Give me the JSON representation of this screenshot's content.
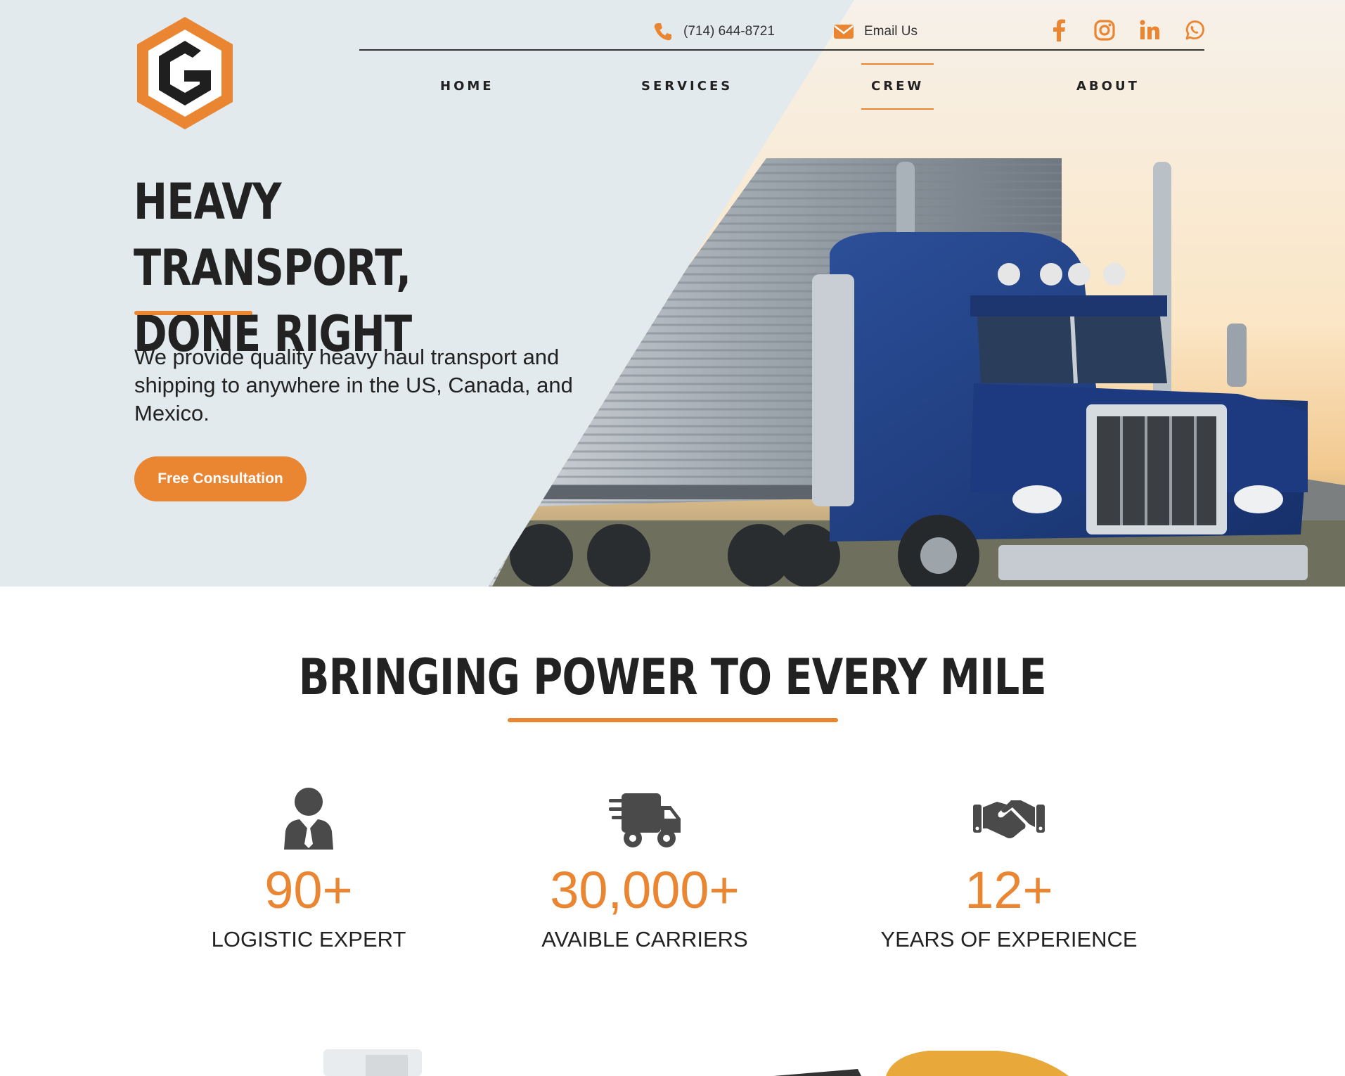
{
  "brand": {
    "accent_color": "#ea8532",
    "dark_color": "#222222",
    "hero_bg": "#e2eaed"
  },
  "header": {
    "logo_icon": "hexagon-g-logo",
    "phone": {
      "icon": "phone-icon",
      "text": "(714) 644-8721"
    },
    "email": {
      "icon": "envelope-icon",
      "text": "Email Us"
    },
    "socials": [
      {
        "name": "facebook",
        "icon": "facebook-icon"
      },
      {
        "name": "instagram",
        "icon": "instagram-icon"
      },
      {
        "name": "linkedin",
        "icon": "linkedin-icon"
      },
      {
        "name": "whatsapp",
        "icon": "whatsapp-icon"
      }
    ],
    "nav": [
      {
        "label": "HOME",
        "active": false
      },
      {
        "label": "SERVICES",
        "active": false
      },
      {
        "label": "CREW",
        "active": true
      },
      {
        "label": "ABOUT",
        "active": false
      }
    ]
  },
  "hero": {
    "title_line1": "HEAVY TRANSPORT,",
    "title_line2": "DONE RIGHT",
    "text": "We provide quality heavy haul transport and shipping to anywhere in the US, Canada, and Mexico.",
    "cta_label": "Free Consultation"
  },
  "stats_section": {
    "title": "BRINGING POWER TO EVERY MILE",
    "items": [
      {
        "icon": "businessman-icon",
        "value": "90+",
        "label": "LOGISTIC EXPERT"
      },
      {
        "icon": "fast-truck-icon",
        "value": "30,000+",
        "label": "AVAIBLE CARRIERS"
      },
      {
        "icon": "handshake-icon",
        "value": "12+",
        "label": "YEARS OF EXPERIENCE"
      }
    ]
  }
}
